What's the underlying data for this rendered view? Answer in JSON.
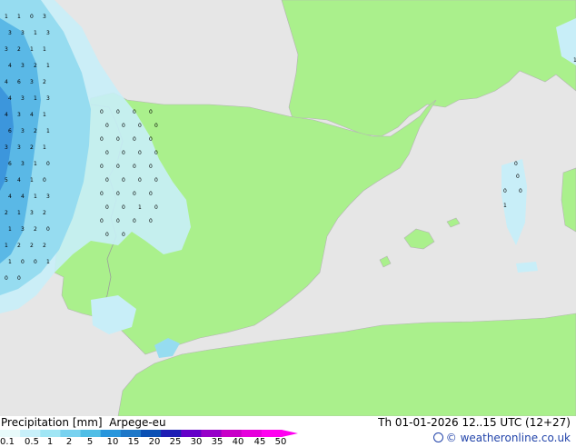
{
  "map": {
    "title": "Precipitation [mm]",
    "model": "Arpege-eu",
    "valid_time": "Th 01-01-2026 12..15 UTC (12+27)",
    "credit": "© weatheronline.co.uk",
    "colors": {
      "sea": "#e6e6e6",
      "land": "#aaf08c",
      "precip_light": "#c8eef8",
      "precip_mid": "#96dcf0",
      "precip_heavy": "#5ab8e6",
      "precip_max": "#3c96dc"
    }
  },
  "legend": {
    "labels": [
      "0.1",
      "0.5",
      "1",
      "2",
      "5",
      "10",
      "15",
      "20",
      "25",
      "30",
      "35",
      "40",
      "45",
      "50"
    ],
    "colors": [
      "#e8fafa",
      "#c8f0fa",
      "#a0e6f5",
      "#78d2f0",
      "#50bee6",
      "#2896dc",
      "#1e78c8",
      "#0a50b4",
      "#1e1eb4",
      "#6400c8",
      "#9600c8",
      "#c800c8",
      "#e600dc",
      "#ff00f0"
    ]
  },
  "grid_values": {
    "left_column": [
      "1",
      "1",
      "0",
      "3",
      "3",
      "3",
      "1",
      "3",
      "3",
      "2",
      "1",
      "1",
      "4",
      "3",
      "2",
      "1",
      "4",
      "6",
      "3",
      "2",
      "4",
      "3",
      "1",
      "3",
      "4",
      "3",
      "4",
      "1",
      "6",
      "3",
      "2",
      "1",
      "3",
      "3",
      "2",
      "1",
      "6",
      "3",
      "1",
      "0",
      "5",
      "4",
      "1",
      "0",
      "4",
      "4",
      "1",
      "3",
      "2",
      "1",
      "3",
      "2",
      "1",
      "3",
      "2",
      "0",
      "1",
      "2",
      "2",
      "2",
      "1",
      "0",
      "0",
      "1",
      "0",
      "0"
    ],
    "land_column": [
      "0",
      "0",
      "0",
      "0",
      "0",
      "0",
      "0",
      "0",
      "0",
      "0",
      "0",
      "0",
      "0",
      "0",
      "0",
      "0",
      "0",
      "0",
      "0",
      "0",
      "0",
      "0",
      "0",
      "0",
      "0",
      "0",
      "0",
      "0",
      "0",
      "0",
      "1",
      "0",
      "0",
      "0",
      "0",
      "0",
      "0",
      "0"
    ],
    "east_values": [
      "0",
      "0",
      "0",
      "0",
      "1",
      "1"
    ]
  }
}
